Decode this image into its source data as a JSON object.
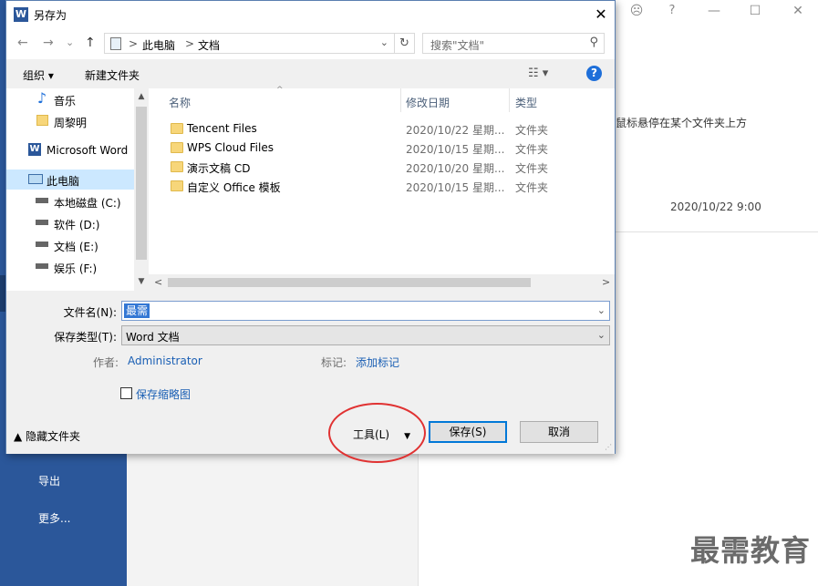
{
  "background": {
    "hint_text": "鼠标悬停在某个文件夹上方",
    "recent_date": "2020/10/22 9:00",
    "nav_items": [
      "导出",
      "更多..."
    ],
    "window_controls": [
      "☹",
      "?",
      "—",
      "☐",
      "✕"
    ],
    "watermark": "最需教育"
  },
  "dialog": {
    "title": "另存为",
    "app_icon": "W",
    "close_glyph": "✕",
    "nav": {
      "back_glyph": "←",
      "forward_glyph": "→",
      "dropdown_glyph": "⌄",
      "up_glyph": "↑",
      "address_separator": ">",
      "address_segments": [
        "此电脑",
        "文档"
      ],
      "refresh_glyph": "↻",
      "search_placeholder": "搜索\"文档\"",
      "search_glyph": "⚲"
    },
    "toolbar": {
      "organize": "组织 ▾",
      "new_folder": "新建文件夹",
      "view_glyph": "☷ ▾",
      "help_glyph": "?"
    },
    "sidebar": {
      "items": [
        {
          "icon": "music-icon",
          "glyph": "♪",
          "label": "音乐"
        },
        {
          "icon": "folder-icon",
          "glyph": "",
          "label": "周黎明"
        },
        {
          "icon": "word-icon",
          "glyph": "W",
          "label": "Microsoft Word"
        },
        {
          "icon": "computer-icon",
          "glyph": "🖳",
          "label": "此电脑"
        },
        {
          "icon": "drive-icon",
          "glyph": "▬",
          "label": "本地磁盘 (C:)"
        },
        {
          "icon": "drive-icon",
          "glyph": "▬",
          "label": "软件 (D:)"
        },
        {
          "icon": "drive-icon",
          "glyph": "▬",
          "label": "文档 (E:)"
        },
        {
          "icon": "drive-icon",
          "glyph": "▬",
          "label": "娱乐 (F:)"
        }
      ],
      "selected_index": 3,
      "scroll_up_glyph": "▲",
      "scroll_down_glyph": "▼"
    },
    "files": {
      "columns": [
        "名称",
        "修改日期",
        "类型"
      ],
      "sort_glyph": "^",
      "rows": [
        {
          "name": "Tencent Files",
          "date": "2020/10/22 星期...",
          "type": "文件夹"
        },
        {
          "name": "WPS Cloud Files",
          "date": "2020/10/15 星期...",
          "type": "文件夹"
        },
        {
          "name": "演示文稿 CD",
          "date": "2020/10/20 星期...",
          "type": "文件夹"
        },
        {
          "name": "自定义 Office 模板",
          "date": "2020/10/15 星期...",
          "type": "文件夹"
        }
      ],
      "hscroll_left_glyph": "<",
      "hscroll_right_glyph": ">"
    },
    "form": {
      "filename_label": "文件名(N):",
      "filename_value": "最需",
      "filetype_label": "保存类型(T):",
      "filetype_value": "Word 文档",
      "dropdown_glyph": "⌄",
      "author_label": "作者:",
      "author_value": "Administrator",
      "tags_label": "标记:",
      "tags_value": "添加标记",
      "thumbnail_label": "保存缩略图"
    },
    "footer": {
      "hide_folders": "▲  隐藏文件夹",
      "tools": "工具(L)",
      "tools_arrow": "▼",
      "save": "保存(S)",
      "cancel": "取消",
      "grip_glyph": "⋰"
    }
  }
}
